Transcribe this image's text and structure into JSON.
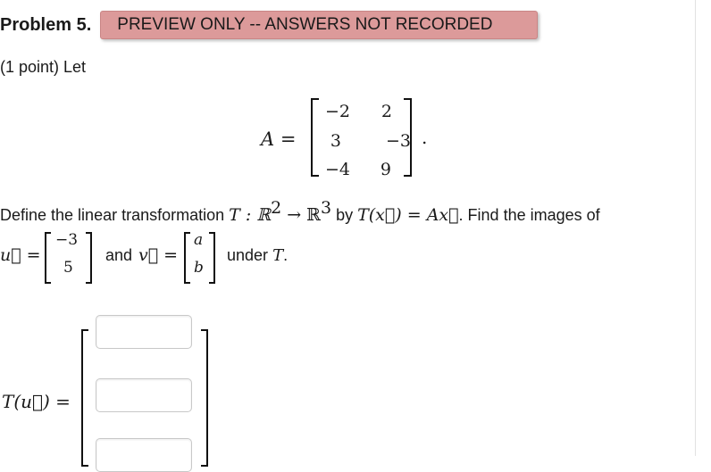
{
  "header": {
    "problem_title": "Problem 5.",
    "preview_banner": "PREVIEW ONLY -- ANSWERS NOT RECORDED",
    "banner_color": "#dc9a9a"
  },
  "intro": "(1 point) Let",
  "matrix": {
    "label": "A =",
    "rows": [
      [
        "−2",
        "2"
      ],
      [
        "3",
        "−3"
      ],
      [
        "−4",
        "9"
      ]
    ],
    "trailing": "."
  },
  "definition": {
    "t1": "Define the linear transformation ",
    "m1": "T : ℝ",
    "exp1": "2",
    "m2": " → ℝ",
    "exp2": "3",
    "t2": " by ",
    "m3": "T(x⃗) = Ax⃗",
    "t3": ". Find the images of"
  },
  "vectors": {
    "u_label": "u⃗ =",
    "u_values": [
      "−3",
      "5"
    ],
    "and_text": "and",
    "v_label": "v⃗ =",
    "v_values": [
      "a",
      "b"
    ],
    "under_text": "under",
    "under_math": "T",
    "end": "."
  },
  "answer": {
    "label": "T(u⃗) =",
    "inputs": [
      {
        "value": "",
        "placeholder": ""
      },
      {
        "value": "",
        "placeholder": ""
      },
      {
        "value": "",
        "placeholder": ""
      }
    ]
  }
}
